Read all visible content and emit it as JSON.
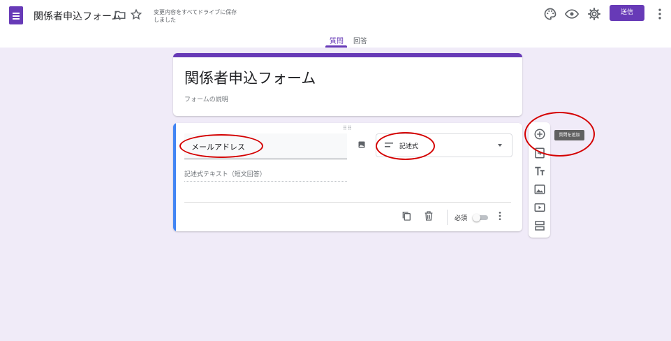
{
  "header": {
    "form_title": "関係者申込フォーム",
    "save_status": "変更内容をすべてドライブに保存しました",
    "send_label": "送信"
  },
  "tabs": [
    {
      "label": "質問",
      "active": true
    },
    {
      "label": "回答",
      "active": false
    }
  ],
  "form": {
    "title": "関係者申込フォーム",
    "description_placeholder": "フォームの説明"
  },
  "question": {
    "title": "メールアドレス",
    "type_label": "記述式",
    "answer_placeholder": "記述式テキスト（短文回答）",
    "required_label": "必須",
    "required": false
  },
  "toolbar": {
    "tooltip": "質問を追加",
    "tools": [
      "add-question-icon",
      "import-questions-icon",
      "add-title-icon",
      "add-image-icon",
      "add-video-icon",
      "add-section-icon"
    ]
  },
  "colors": {
    "accent": "#673ab7",
    "background": "#f0ebf8",
    "active_question": "#4285f4",
    "annotation": "#d40000"
  }
}
